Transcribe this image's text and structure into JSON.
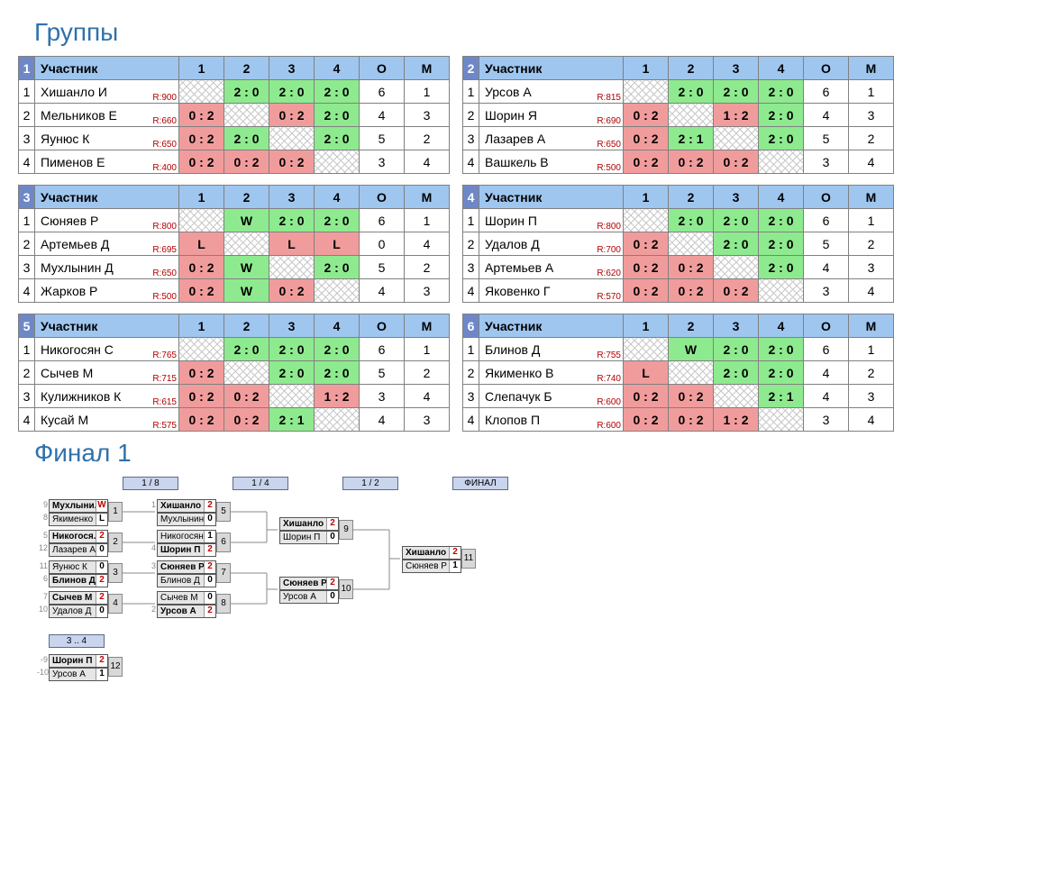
{
  "title_groups": "Группы",
  "title_final": "Финал 1",
  "headers": {
    "participant": "Участник",
    "o": "О",
    "m": "М"
  },
  "ratingPrefix": "R:",
  "groups": [
    {
      "num": 1,
      "players": [
        {
          "name": "Хишанло И",
          "rating": 900,
          "cells": [
            "X",
            "2 : 0",
            "2 : 0",
            "2 : 0"
          ],
          "o": 6,
          "m": 1
        },
        {
          "name": "Мельников Е",
          "rating": 660,
          "cells": [
            "0 : 2",
            "X",
            "0 : 2",
            "2 : 0"
          ],
          "o": 4,
          "m": 3
        },
        {
          "name": "Яунюс К",
          "rating": 650,
          "cells": [
            "0 : 2",
            "2 : 0",
            "X",
            "2 : 0"
          ],
          "o": 5,
          "m": 2
        },
        {
          "name": "Пименов Е",
          "rating": 400,
          "cells": [
            "0 : 2",
            "0 : 2",
            "0 : 2",
            "X"
          ],
          "o": 3,
          "m": 4
        }
      ]
    },
    {
      "num": 2,
      "players": [
        {
          "name": "Урсов А",
          "rating": 815,
          "cells": [
            "X",
            "2 : 0",
            "2 : 0",
            "2 : 0"
          ],
          "o": 6,
          "m": 1
        },
        {
          "name": "Шорин Я",
          "rating": 690,
          "cells": [
            "0 : 2",
            "X",
            "1 : 2",
            "2 : 0"
          ],
          "o": 4,
          "m": 3
        },
        {
          "name": "Лазарев А",
          "rating": 650,
          "cells": [
            "0 : 2",
            "2 : 1",
            "X",
            "2 : 0"
          ],
          "o": 5,
          "m": 2
        },
        {
          "name": "Вашкель В",
          "rating": 500,
          "cells": [
            "0 : 2",
            "0 : 2",
            "0 : 2",
            "X"
          ],
          "o": 3,
          "m": 4
        }
      ]
    },
    {
      "num": 3,
      "players": [
        {
          "name": "Сюняев Р",
          "rating": 800,
          "cells": [
            "X",
            "W",
            "2 : 0",
            "2 : 0"
          ],
          "o": 6,
          "m": 1
        },
        {
          "name": "Артемьев Д",
          "rating": 695,
          "cells": [
            "L",
            "X",
            "L",
            "L"
          ],
          "o": 0,
          "m": 4
        },
        {
          "name": "Мухлынин Д",
          "rating": 650,
          "cells": [
            "0 : 2",
            "W",
            "X",
            "2 : 0"
          ],
          "o": 5,
          "m": 2
        },
        {
          "name": "Жарков Р",
          "rating": 500,
          "cells": [
            "0 : 2",
            "W",
            "0 : 2",
            "X"
          ],
          "o": 4,
          "m": 3
        }
      ]
    },
    {
      "num": 4,
      "players": [
        {
          "name": "Шорин П",
          "rating": 800,
          "cells": [
            "X",
            "2 : 0",
            "2 : 0",
            "2 : 0"
          ],
          "o": 6,
          "m": 1
        },
        {
          "name": "Удалов Д",
          "rating": 700,
          "cells": [
            "0 : 2",
            "X",
            "2 : 0",
            "2 : 0"
          ],
          "o": 5,
          "m": 2
        },
        {
          "name": "Артемьев А",
          "rating": 620,
          "cells": [
            "0 : 2",
            "0 : 2",
            "X",
            "2 : 0"
          ],
          "o": 4,
          "m": 3
        },
        {
          "name": "Яковенко Г",
          "rating": 570,
          "cells": [
            "0 : 2",
            "0 : 2",
            "0 : 2",
            "X"
          ],
          "o": 3,
          "m": 4
        }
      ]
    },
    {
      "num": 5,
      "players": [
        {
          "name": "Никогосян С",
          "rating": 765,
          "cells": [
            "X",
            "2 : 0",
            "2 : 0",
            "2 : 0"
          ],
          "o": 6,
          "m": 1
        },
        {
          "name": "Сычев М",
          "rating": 715,
          "cells": [
            "0 : 2",
            "X",
            "2 : 0",
            "2 : 0"
          ],
          "o": 5,
          "m": 2
        },
        {
          "name": "Кулижников К",
          "rating": 615,
          "cells": [
            "0 : 2",
            "0 : 2",
            "X",
            "1 : 2"
          ],
          "o": 3,
          "m": 4
        },
        {
          "name": "Кусай М",
          "rating": 575,
          "cells": [
            "0 : 2",
            "0 : 2",
            "2 : 1",
            "X"
          ],
          "o": 4,
          "m": 3
        }
      ]
    },
    {
      "num": 6,
      "players": [
        {
          "name": "Блинов Д",
          "rating": 755,
          "cells": [
            "X",
            "W",
            "2 : 0",
            "2 : 0"
          ],
          "o": 6,
          "m": 1
        },
        {
          "name": "Якименко В",
          "rating": 740,
          "cells": [
            "L",
            "X",
            "2 : 0",
            "2 : 0"
          ],
          "o": 4,
          "m": 2
        },
        {
          "name": "Слепачук Б",
          "rating": 600,
          "cells": [
            "0 : 2",
            "0 : 2",
            "X",
            "2 : 1"
          ],
          "o": 4,
          "m": 3
        },
        {
          "name": "Клопов П",
          "rating": 600,
          "cells": [
            "0 : 2",
            "0 : 2",
            "1 : 2",
            "X"
          ],
          "o": 3,
          "m": 4
        }
      ]
    }
  ],
  "rounds": [
    "1 / 8",
    "1 / 4",
    "1 / 2",
    "ФИНАЛ"
  ],
  "round34": "3 .. 4",
  "bracket": {
    "r8": [
      {
        "num": 1,
        "seeds": [
          9,
          8
        ],
        "p": [
          {
            "n": "Мухлыни...",
            "s": "W",
            "w": true
          },
          {
            "n": "Якименко В",
            "s": "L"
          }
        ]
      },
      {
        "num": 2,
        "seeds": [
          5,
          12
        ],
        "p": [
          {
            "n": "Никогося...",
            "s": "2",
            "w": true
          },
          {
            "n": "Лазарев А",
            "s": "0"
          }
        ]
      },
      {
        "num": 3,
        "seeds": [
          11,
          6
        ],
        "p": [
          {
            "n": "Яунюс К",
            "s": "0"
          },
          {
            "n": "Блинов Д",
            "s": "2",
            "w": true
          }
        ]
      },
      {
        "num": 4,
        "seeds": [
          7,
          10
        ],
        "p": [
          {
            "n": "Сычев М",
            "s": "2",
            "w": true
          },
          {
            "n": "Удалов Д",
            "s": "0"
          }
        ]
      }
    ],
    "r4": [
      {
        "num": 5,
        "seeds": [
          1,
          null
        ],
        "p": [
          {
            "n": "Хишанло И",
            "s": "2",
            "w": true
          },
          {
            "n": "Мухлынин Д",
            "s": "0"
          }
        ]
      },
      {
        "num": 6,
        "seeds": [
          null,
          4
        ],
        "p": [
          {
            "n": "Никогосян С",
            "s": "1"
          },
          {
            "n": "Шорин П",
            "s": "2",
            "w": true
          }
        ]
      },
      {
        "num": 7,
        "seeds": [
          3,
          null
        ],
        "p": [
          {
            "n": "Сюняев Р",
            "s": "2",
            "w": true
          },
          {
            "n": "Блинов Д",
            "s": "0"
          }
        ]
      },
      {
        "num": 8,
        "seeds": [
          null,
          2
        ],
        "p": [
          {
            "n": "Сычев М",
            "s": "0"
          },
          {
            "n": "Урсов А",
            "s": "2",
            "w": true
          }
        ]
      }
    ],
    "r2": [
      {
        "num": 9,
        "p": [
          {
            "n": "Хишанло И",
            "s": "2",
            "w": true
          },
          {
            "n": "Шорин П",
            "s": "0"
          }
        ]
      },
      {
        "num": 10,
        "p": [
          {
            "n": "Сюняев Р",
            "s": "2",
            "w": true
          },
          {
            "n": "Урсов А",
            "s": "0"
          }
        ]
      }
    ],
    "final": [
      {
        "num": 11,
        "p": [
          {
            "n": "Хишанло И",
            "s": "2",
            "w": true
          },
          {
            "n": "Сюняев Р",
            "s": "1"
          }
        ]
      }
    ],
    "third": [
      {
        "num": 12,
        "seeds": [
          -9,
          -10
        ],
        "p": [
          {
            "n": "Шорин П",
            "s": "2",
            "w": true
          },
          {
            "n": "Урсов А",
            "s": "1"
          }
        ]
      }
    ]
  }
}
